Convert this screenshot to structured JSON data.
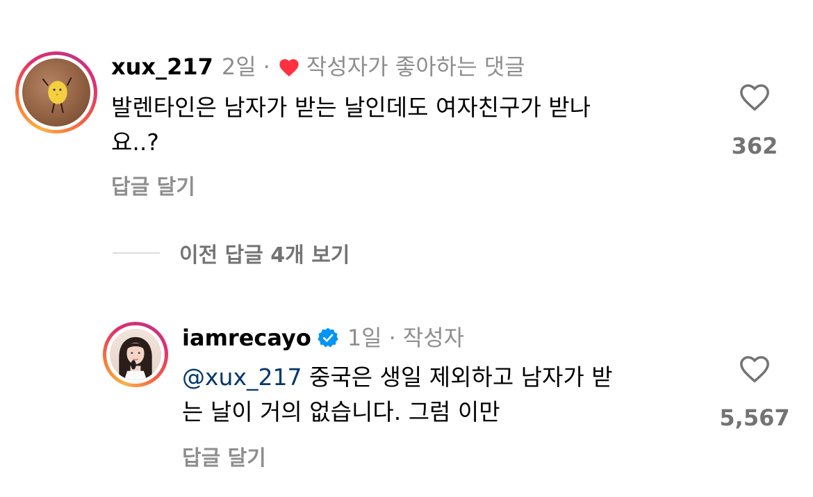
{
  "comment1": {
    "username": "xux_217",
    "time": "2일",
    "liked_by_author_label": "작성자가 좋아하는 댓글",
    "text_line1": "발렌타인은 남자가 받는 날인데도 여자친구가 받나",
    "text_line2": "요..?",
    "like_count": "362",
    "reply_label": "답글 달기"
  },
  "view_previous": {
    "label": "이전 답글 4개 보기"
  },
  "reply1": {
    "username": "iamrecayo",
    "time": "1일",
    "author_badge": "작성자",
    "mention": "@xux_217",
    "text_line1_rest": "중국은 생일 제외하고 남자가 받",
    "text_line2": "는 날이 거의 없습니다. 그럼 이만",
    "like_count": "5,567",
    "reply_label": "답글 달기"
  },
  "colors": {
    "heart_red": "#ff3040",
    "verified_blue": "#0095f6",
    "meta_gray": "#8e8e8e",
    "mention_blue": "#00376b"
  },
  "icons": [
    "heart-filled-icon",
    "heart-outline-icon",
    "verified-badge-icon"
  ]
}
